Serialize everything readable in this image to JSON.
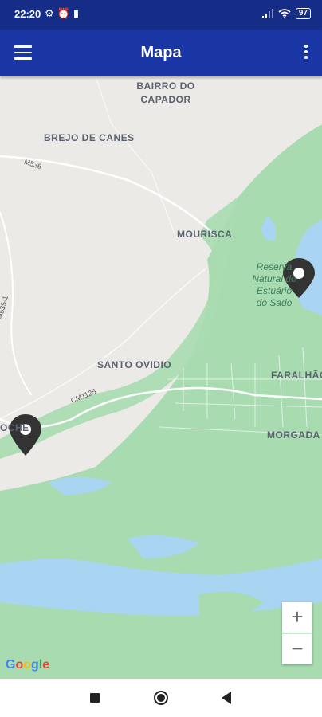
{
  "status_bar": {
    "time": "22:20",
    "battery": "97"
  },
  "app_bar": {
    "title": "Mapa"
  },
  "map": {
    "places": {
      "bairro": "BAIRRO DO\nCAPADOR",
      "brejo": "BREJO DE CANES",
      "mourisca": "MOURISCA",
      "santo_ovidio": "SANTO OVIDIO",
      "faralhao": "FARALHÃO",
      "morgada": "MORGADA",
      "cachofarra_partial": "OCHE"
    },
    "roads": {
      "m536": "M536",
      "m535": "M535-1",
      "cm1125": "CM1125"
    },
    "reserve_label": "Reserva\nNatural do\nEstuário\ndo Sado",
    "attribution": "Google",
    "zoom_in": "+",
    "zoom_out": "−"
  },
  "colors": {
    "status_bar": "#152d87",
    "app_bar": "#1a36a5",
    "land": "#eceae6",
    "vegetation": "#a8dcb0",
    "water": "#a9d4f2"
  }
}
